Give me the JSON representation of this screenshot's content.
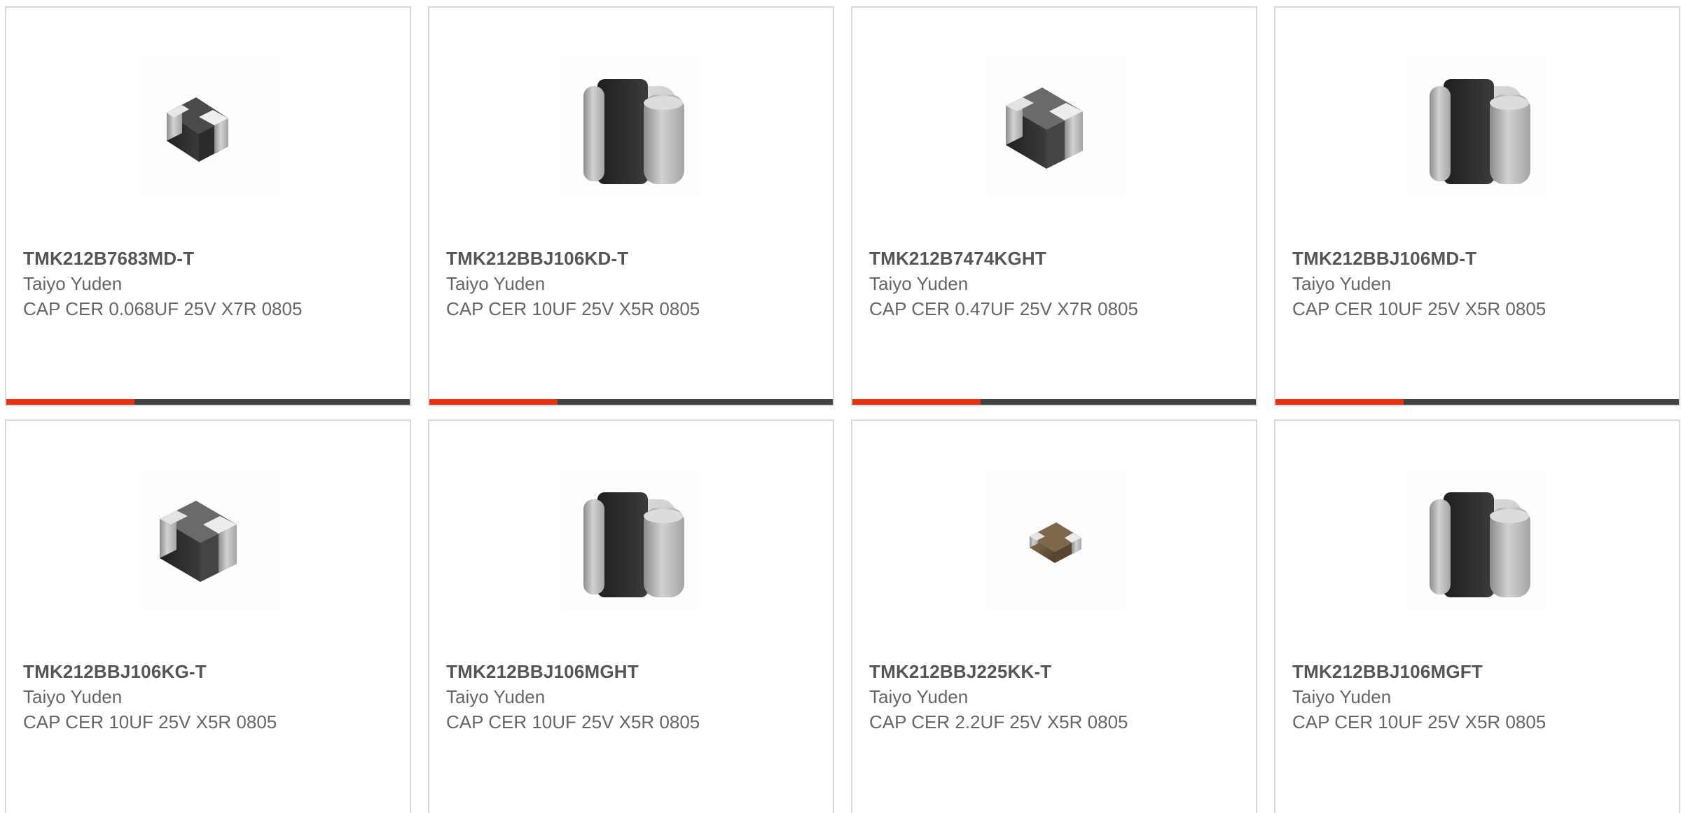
{
  "products": [
    {
      "part_number": "TMK212B7683MD-T",
      "manufacturer": "Taiyo Yuden",
      "description": "CAP CER 0.068UF 25V X7R 0805",
      "image": "capacitor-chip-icon"
    },
    {
      "part_number": "TMK212BBJ106KD-T",
      "manufacturer": "Taiyo Yuden",
      "description": "CAP CER 10UF 25V X5R 0805",
      "image": "capacitor-chip-icon"
    },
    {
      "part_number": "TMK212B7474KGHT",
      "manufacturer": "Taiyo Yuden",
      "description": "CAP CER 0.47UF 25V X7R 0805",
      "image": "capacitor-chip-icon"
    },
    {
      "part_number": "TMK212BBJ106MD-T",
      "manufacturer": "Taiyo Yuden",
      "description": "CAP CER 10UF 25V X5R 0805",
      "image": "capacitor-chip-icon"
    },
    {
      "part_number": "TMK212BBJ106KG-T",
      "manufacturer": "Taiyo Yuden",
      "description": "CAP CER 10UF 25V X5R 0805",
      "image": "capacitor-chip-icon"
    },
    {
      "part_number": "TMK212BBJ106MGHT",
      "manufacturer": "Taiyo Yuden",
      "description": "CAP CER 10UF 25V X5R 0805",
      "image": "capacitor-chip-icon"
    },
    {
      "part_number": "TMK212BBJ225KK-T",
      "manufacturer": "Taiyo Yuden",
      "description": "CAP CER 2.2UF 25V X5R 0805",
      "image": "capacitor-chip-brown-icon"
    },
    {
      "part_number": "TMK212BBJ106MGFT",
      "manufacturer": "Taiyo Yuden",
      "description": "CAP CER 10UF 25V X5R 0805",
      "image": "capacitor-chip-icon"
    }
  ],
  "colors": {
    "accent": "#e5330f",
    "bar": "#424242",
    "border": "#d9d9d9",
    "part_number_text": "#555555",
    "body_text": "#666666"
  }
}
